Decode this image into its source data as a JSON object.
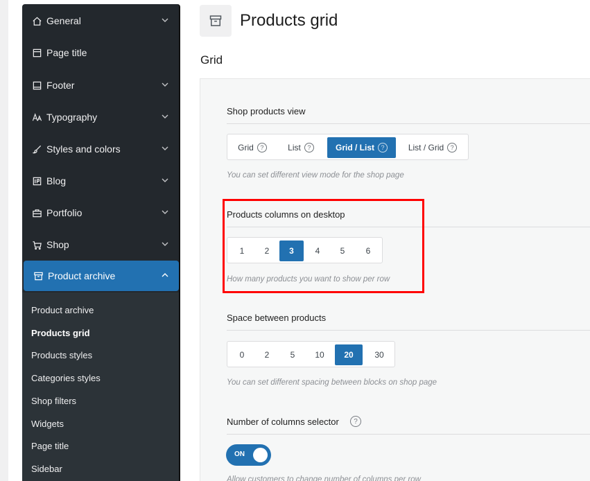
{
  "sidebar": {
    "items": [
      {
        "label": "General",
        "icon": "home-icon"
      },
      {
        "label": "Page title",
        "icon": "page-icon"
      },
      {
        "label": "Footer",
        "icon": "footer-icon"
      },
      {
        "label": "Typography",
        "icon": "typography-icon"
      },
      {
        "label": "Styles and colors",
        "icon": "brush-icon"
      },
      {
        "label": "Blog",
        "icon": "blog-icon"
      },
      {
        "label": "Portfolio",
        "icon": "briefcase-icon"
      },
      {
        "label": "Shop",
        "icon": "cart-icon"
      },
      {
        "label": "Product archive",
        "icon": "archive-icon"
      }
    ],
    "subitems": [
      {
        "label": "Product archive"
      },
      {
        "label": "Products grid"
      },
      {
        "label": "Products styles"
      },
      {
        "label": "Categories styles"
      },
      {
        "label": "Shop filters"
      },
      {
        "label": "Widgets"
      },
      {
        "label": "Page title"
      },
      {
        "label": "Sidebar"
      }
    ],
    "active_color": "#2271b1",
    "bg_color": "#23282d"
  },
  "header": {
    "title": "Products grid",
    "icon": "archive-icon"
  },
  "section": {
    "title": "Grid"
  },
  "options": {
    "shop_view": {
      "label": "Shop products view",
      "choices": [
        "Grid",
        "List",
        "Grid / List",
        "List / Grid"
      ],
      "selected": "Grid / List",
      "help": "You can set different view mode for the shop page"
    },
    "columns_desktop": {
      "label": "Products columns on desktop",
      "choices": [
        "1",
        "2",
        "3",
        "4",
        "5",
        "6"
      ],
      "selected": "3",
      "help": "How many products you want to show per row"
    },
    "spacing": {
      "label": "Space between products",
      "choices": [
        "0",
        "2",
        "5",
        "10",
        "20",
        "30"
      ],
      "selected": "20",
      "help": "You can set different spacing between blocks on shop page"
    },
    "columns_selector": {
      "label": "Number of columns selector",
      "toggle": "ON",
      "help": "Allow customers to change number of columns per row"
    }
  },
  "highlight_color": "#ff0000"
}
